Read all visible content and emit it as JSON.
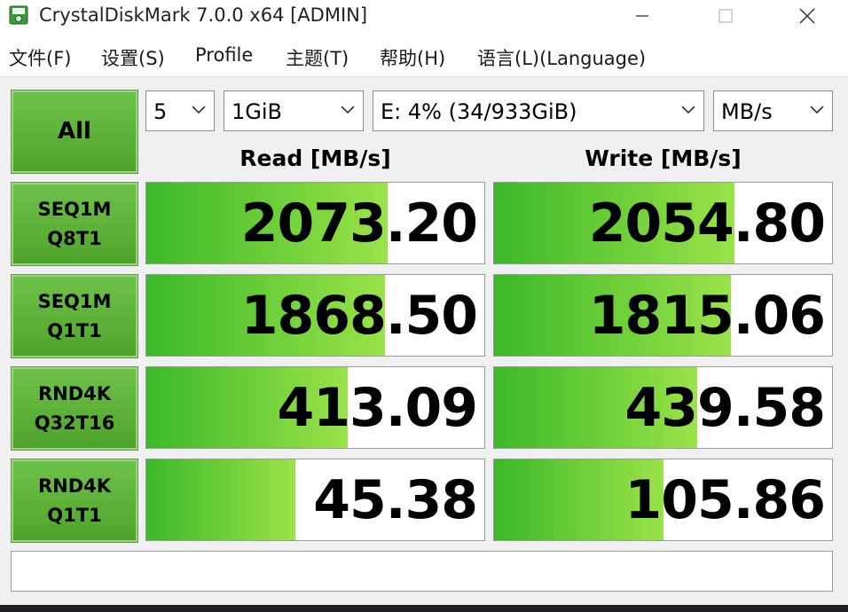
{
  "window": {
    "title": "CrystalDiskMark 7.0.0 x64 [ADMIN]",
    "app_icon": "disk-icon"
  },
  "menu": [
    {
      "label": "文件(F)"
    },
    {
      "label": "设置(S)"
    },
    {
      "label": "Profile"
    },
    {
      "label": "主题(T)"
    },
    {
      "label": "帮助(H)"
    },
    {
      "label": "语言(L)(Language)"
    }
  ],
  "controls": {
    "all_label": "All",
    "count": "5",
    "size": "1GiB",
    "drive": "E: 4% (34/933GiB)",
    "unit": "MB/s"
  },
  "headers": {
    "read": "Read [MB/s]",
    "write": "Write [MB/s]"
  },
  "max_value_mbps": 2500,
  "rows": [
    {
      "line1": "SEQ1M",
      "line2": "Q8T1",
      "read": "2073.20",
      "write": "2054.80",
      "read_fill": 0.715,
      "write_fill": 0.71
    },
    {
      "line1": "SEQ1M",
      "line2": "Q1T1",
      "read": "1868.50",
      "write": "1815.06",
      "read_fill": 0.705,
      "write_fill": 0.7
    },
    {
      "line1": "RND4K",
      "line2": "Q32T16",
      "read": "413.09",
      "write": "439.58",
      "read_fill": 0.595,
      "write_fill": 0.6
    },
    {
      "line1": "RND4K",
      "line2": "Q1T1",
      "read": "45.38",
      "write": "105.86",
      "read_fill": 0.44,
      "write_fill": 0.5
    }
  ],
  "status_text": "",
  "colors": {
    "tile_green": "#5cb338",
    "bar_green": "#7ed63e"
  }
}
